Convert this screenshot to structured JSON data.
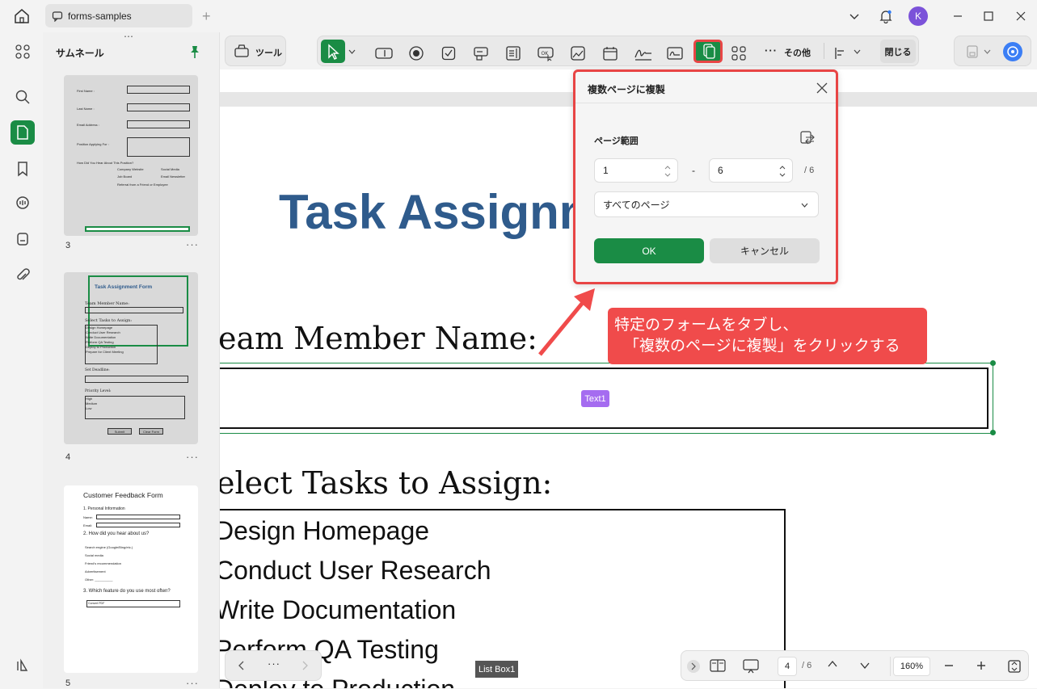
{
  "tab": {
    "title": "forms-samples"
  },
  "user": {
    "initial": "K"
  },
  "sidebar": {
    "title": "サムネール",
    "pages": [
      "3",
      "4",
      "5"
    ]
  },
  "toolbar": {
    "tools_label": "ツール",
    "more_label": "その他",
    "close_label": "閉じる"
  },
  "thumbs": {
    "p3": {
      "first_name": "First Name :",
      "last_name": "Last Name :",
      "email": "Email Address :",
      "position": "Position Applying For :",
      "hear": "How Did You Hear About This Position?",
      "opt1": "Company Website",
      "opt2": "Social Media",
      "opt3": "Job Board",
      "opt4": "Email Newsletter",
      "opt5": "Referral from a Friend or Employee"
    },
    "p4": {
      "title": "Task Assignment Form",
      "member": "Team Member Name:",
      "select": "Select Tasks to Assign:",
      "tasks": [
        "Design Homepage",
        "Conduct User Research",
        "Write Documentation",
        "Perform QA Testing",
        "Deploy to Production",
        "Prepare for Client Meeting"
      ],
      "deadline": "Set Deadline:",
      "priority": "Priority Level:",
      "levels": [
        "High",
        "Medium",
        "Low"
      ],
      "submit": "Submit",
      "clear": "Clear Form"
    },
    "p5": {
      "title": "Customer Feedback Form",
      "s1": "1. Personal Information",
      "name": "Name:",
      "email": "Email:",
      "s2": "2. How did you hear about us?",
      "o1": "Search engine (Google/Bing/etc.)",
      "o2": "Social media",
      "o3": "Friend's recommendation",
      "o4": "Advertisement",
      "o5": "Other: __________",
      "s3": "3. Which feature do you use most often?",
      "dropdown": "Convert PDF"
    }
  },
  "document": {
    "title": "Task Assignm",
    "member_label": "eam Member Name:",
    "text_field_tag": "Text1",
    "select_label": "elect Tasks to Assign:",
    "tasks": [
      "Design Homepage",
      "Conduct User Research",
      "Write Documentation",
      "Perform QA Testing",
      "Deploy to Production"
    ],
    "listbox_tag": "List Box1"
  },
  "dialog": {
    "title": "複数ページに複製",
    "range_label": "ページ範囲",
    "from": "1",
    "to": "6",
    "total": "/ 6",
    "dash": "-",
    "select_value": "すべてのページ",
    "ok": "OK",
    "cancel": "キャンセル"
  },
  "callout": {
    "line1": "特定のフォームをタブし、",
    "line2": "「複数のページに複製」をクリックする"
  },
  "statusbar": {
    "page": "4",
    "total": "/ 6",
    "zoom": "160%"
  },
  "colors": {
    "accent": "#1a8c45",
    "highlight": "#e84545",
    "title_blue": "#2f5b8c",
    "tag_purple": "#a56cf0"
  }
}
